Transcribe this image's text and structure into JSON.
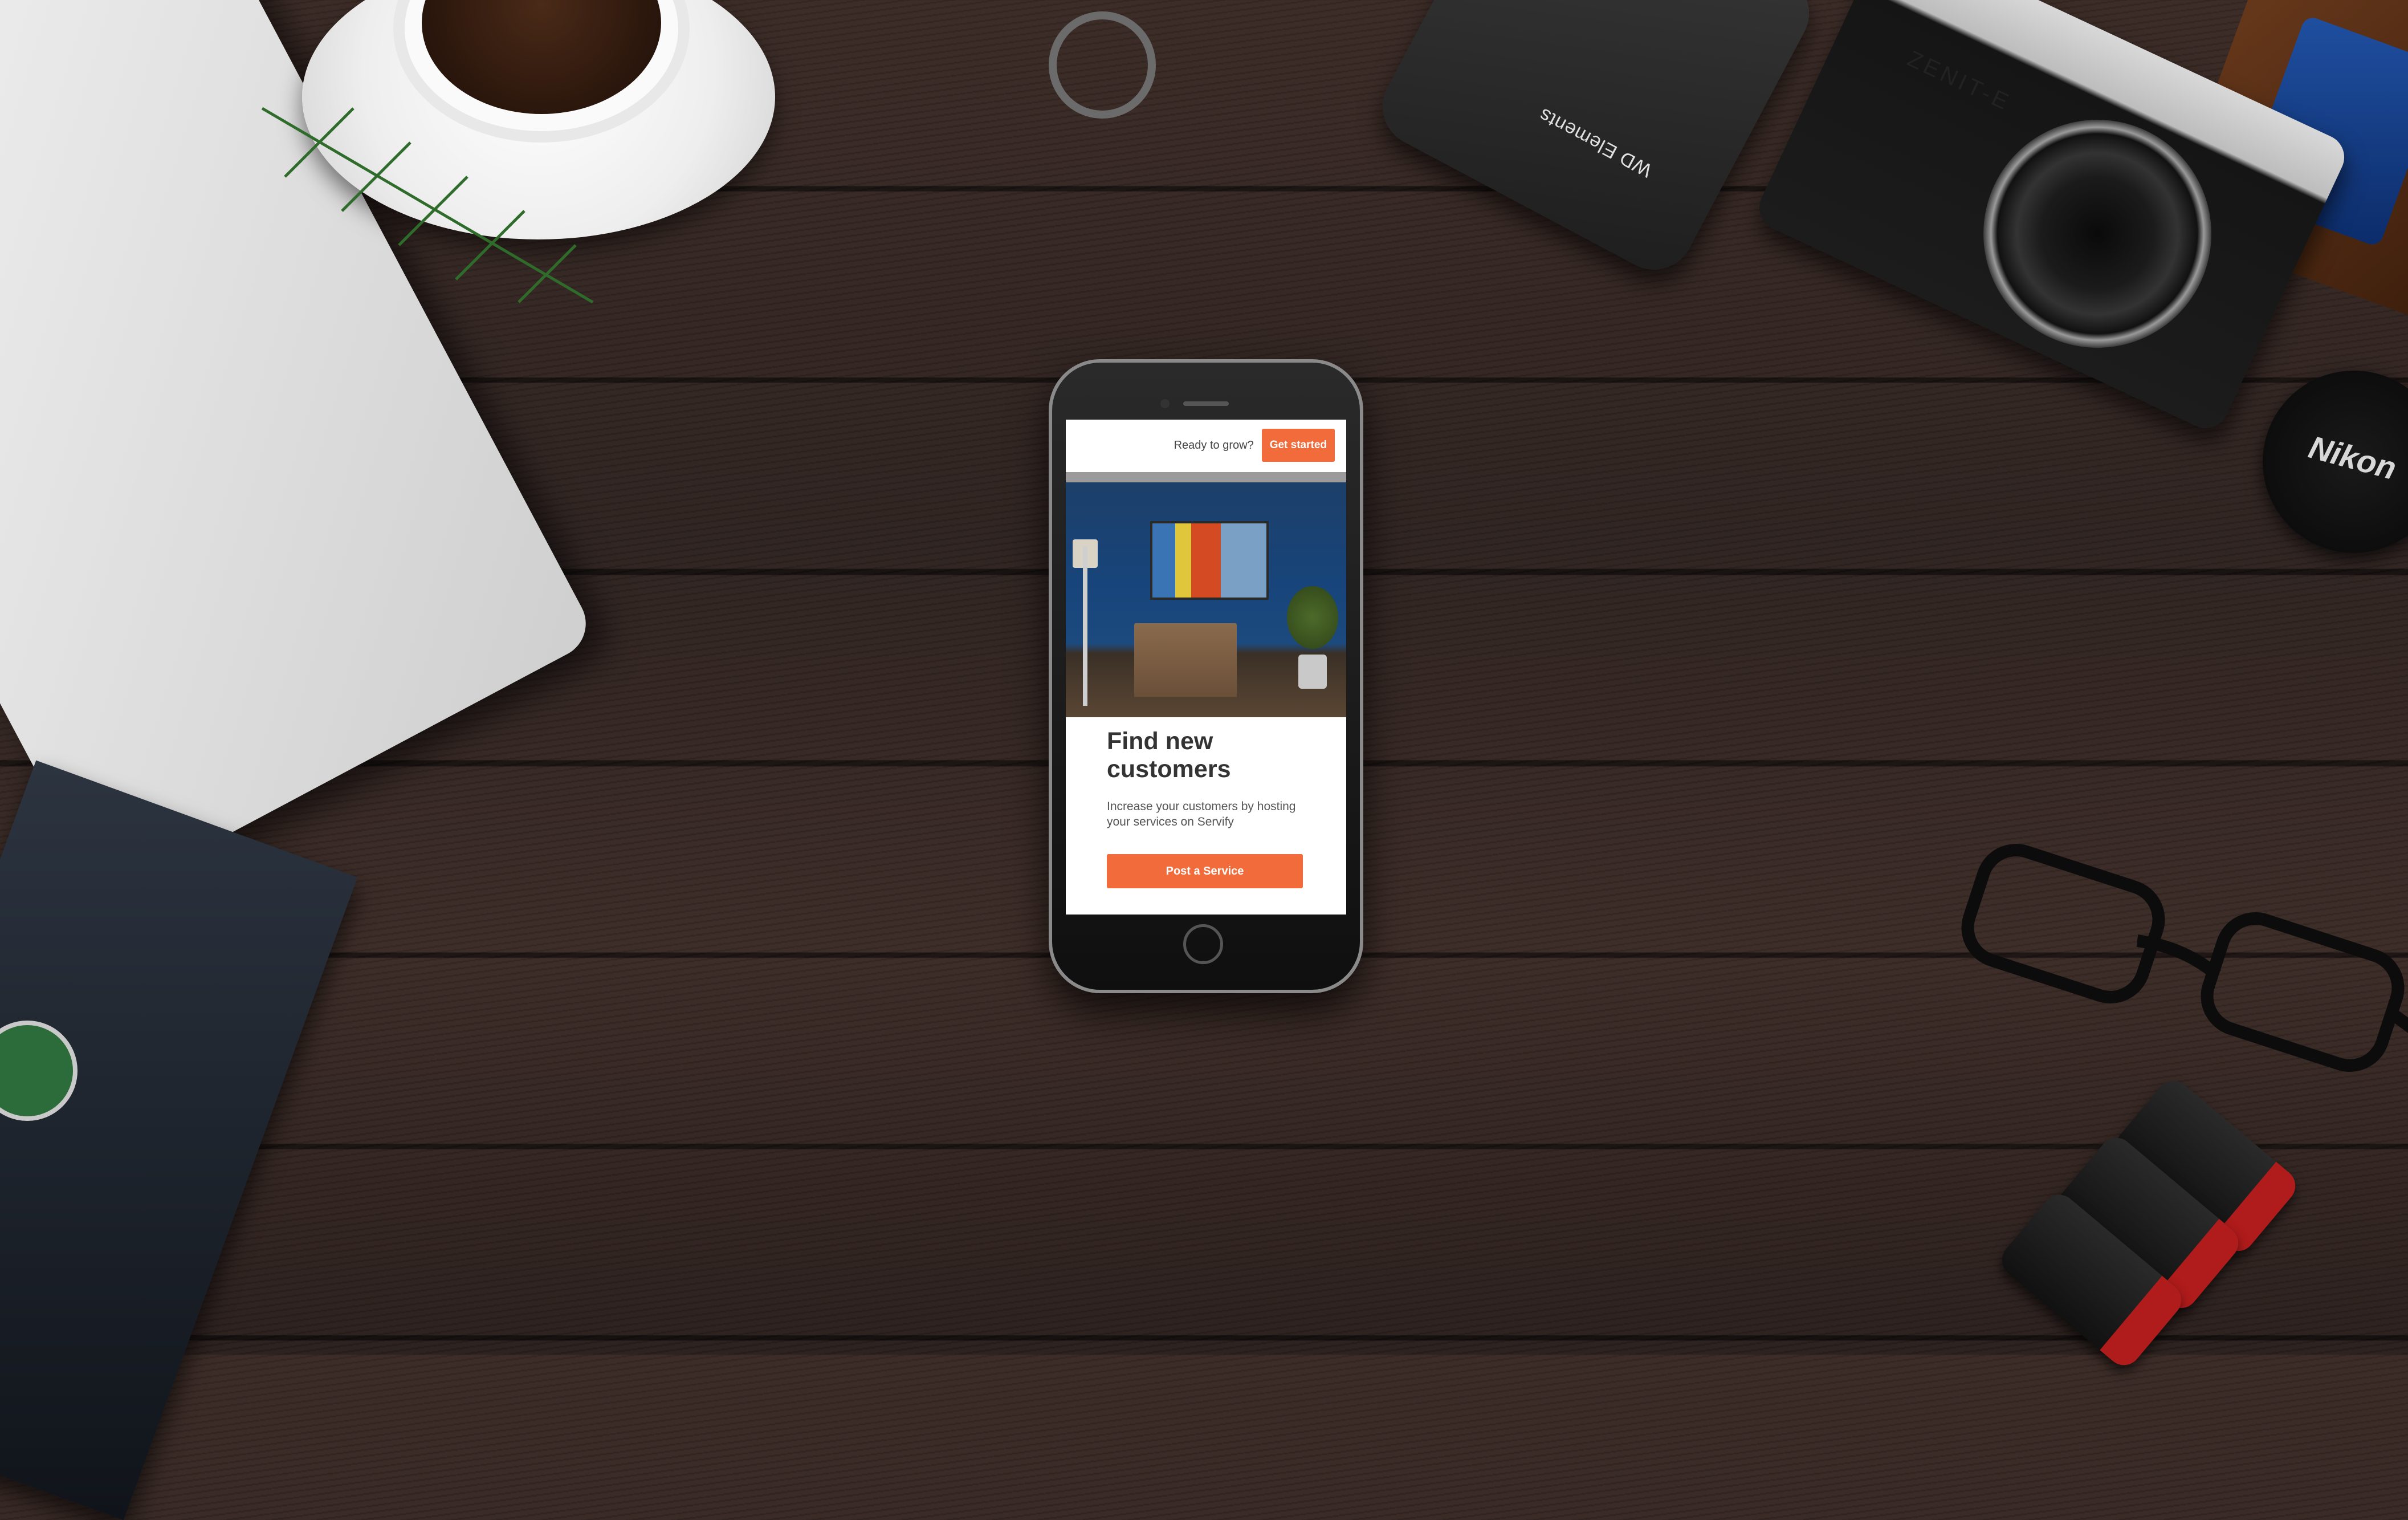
{
  "desk_props": {
    "hdd_label": "WD Elements",
    "camera_label": "ZENIT-E",
    "lenscap_label": "Nikon"
  },
  "app": {
    "header": {
      "prompt": "Ready to grow?",
      "cta_label": "Get started"
    },
    "hero": {
      "title": "Find new customers",
      "subtitle": "Increase your customers by hosting your services on Servify",
      "button_label": "Post a Service"
    }
  },
  "colors": {
    "accent": "#f26b3a",
    "title_text": "#333333",
    "body_text": "#555555"
  }
}
